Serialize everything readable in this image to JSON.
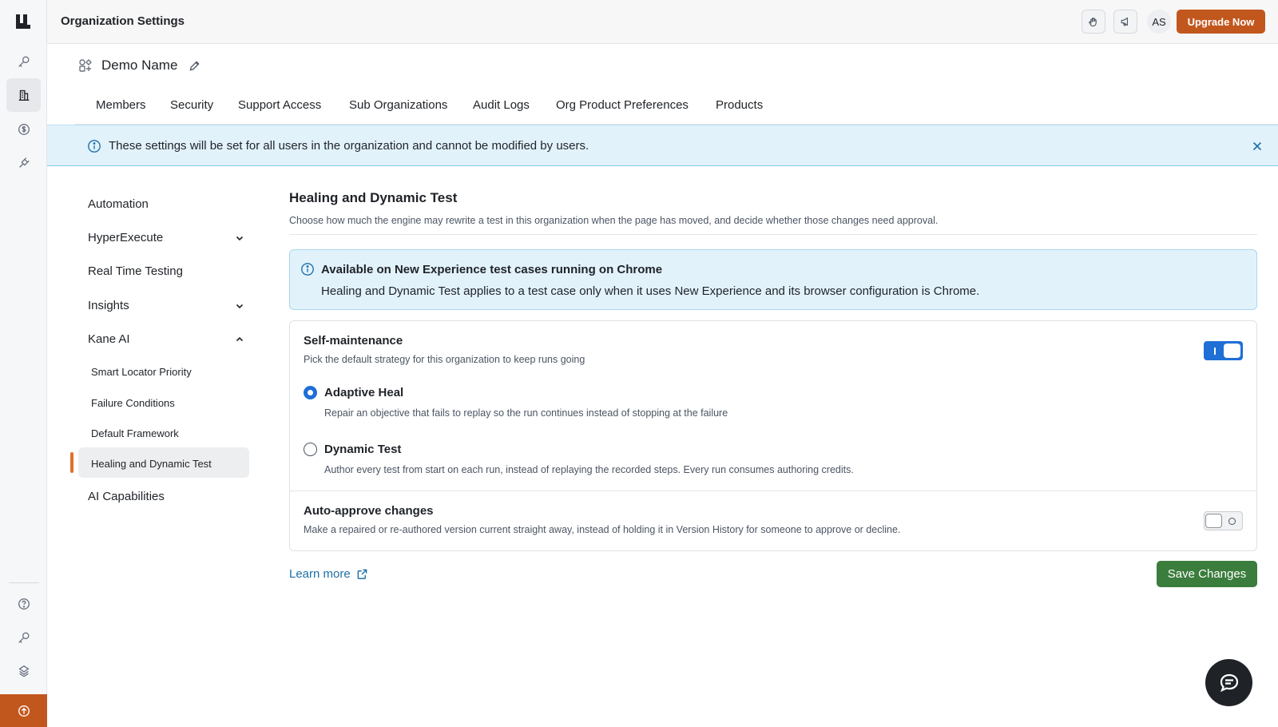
{
  "header": {
    "title": "Organization Settings",
    "avatar_initials": "AS",
    "upgrade_label": "Upgrade Now"
  },
  "org": {
    "name": "Demo Name"
  },
  "tabs": [
    {
      "label": "Members"
    },
    {
      "label": "Security"
    },
    {
      "label": "Support Access"
    },
    {
      "label": "Sub Organizations"
    },
    {
      "label": "Audit Logs"
    },
    {
      "label": "Org Product Preferences"
    },
    {
      "label": "Products"
    }
  ],
  "banner": {
    "text": "These settings will be set for all users in the organization and cannot be modified by users."
  },
  "subnav": {
    "items": [
      {
        "label": "Automation"
      },
      {
        "label": "HyperExecute"
      },
      {
        "label": "Real Time Testing"
      },
      {
        "label": "Insights"
      },
      {
        "label": "Kane AI"
      },
      {
        "label": "AI Capabilities"
      }
    ],
    "kane_children": [
      {
        "label": "Smart Locator Priority"
      },
      {
        "label": "Failure Conditions"
      },
      {
        "label": "Default Framework"
      },
      {
        "label": "Healing and Dynamic Test"
      }
    ]
  },
  "main": {
    "title": "Healing and Dynamic Test",
    "description": "Choose how much the engine may rewrite a test in this organization when the page has moved, and decide whether those changes need approval.",
    "info_title": "Available on New Experience test cases running on Chrome",
    "info_text": "Healing and Dynamic Test applies to a test case only when it uses New Experience and its browser configuration is Chrome.",
    "self_maintenance": {
      "title": "Self-maintenance",
      "description": "Pick the default strategy for this organization to keep runs going",
      "enabled": true,
      "options": [
        {
          "label": "Adaptive Heal",
          "description": "Repair an objective that fails to replay so the run continues instead of stopping at the failure",
          "selected": true
        },
        {
          "label": "Dynamic Test",
          "description": "Author every test from start on each run, instead of replaying the recorded steps. Every run consumes authoring credits.",
          "selected": false
        }
      ]
    },
    "auto_approve": {
      "title": "Auto-approve changes",
      "description": "Make a repaired or re-authored version current straight away, instead of holding it in Version History for someone to approve or decline.",
      "enabled": false
    },
    "learn_more_label": "Learn more",
    "save_label": "Save Changes"
  },
  "colors": {
    "accent_orange": "#c2571e",
    "primary_blue": "#1f6fd6",
    "info_blue_bg": "#e2f2fb",
    "save_green": "#3b7d3d"
  }
}
